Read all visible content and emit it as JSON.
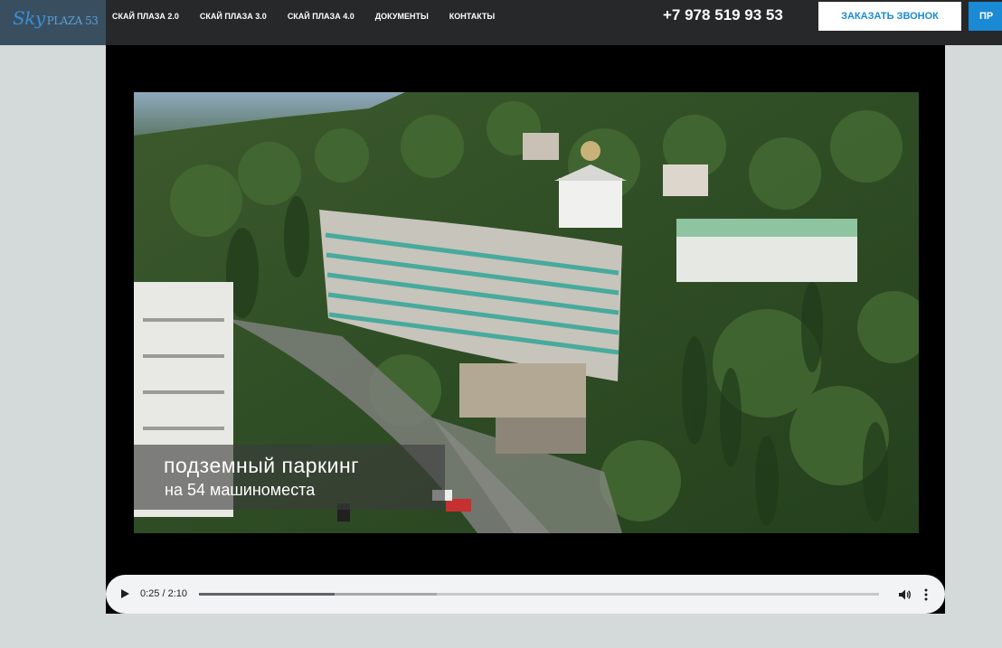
{
  "brand": {
    "logo_text": "Sky",
    "logo_sub": "PLAZA 53"
  },
  "nav": {
    "items": [
      {
        "label": "СКАЙ ПЛАЗА 2.0"
      },
      {
        "label": "СКАЙ ПЛАЗА 3.0"
      },
      {
        "label": "СКАЙ ПЛАЗА 4.0"
      },
      {
        "label": "ДОКУМЕНТЫ"
      },
      {
        "label": "КОНТАКТЫ"
      }
    ]
  },
  "header": {
    "phone": "+7 978 519 93 53",
    "call_button": "ЗАКАЗАТЬ ЗВОНОК",
    "second_button": "ПР"
  },
  "video": {
    "caption_line1": "подземный паркинг",
    "caption_line2": "на 54 машиноместа",
    "current_time": "0:25",
    "duration": "2:10",
    "time_display": "0:25 / 2:10",
    "played_fraction": 0.2,
    "buffered_fraction": 0.35
  },
  "colors": {
    "header_bg": "#272829",
    "accent": "#1a8ad4",
    "page_bg": "#d4d9d9",
    "controls_bg": "#f1f3f4"
  }
}
